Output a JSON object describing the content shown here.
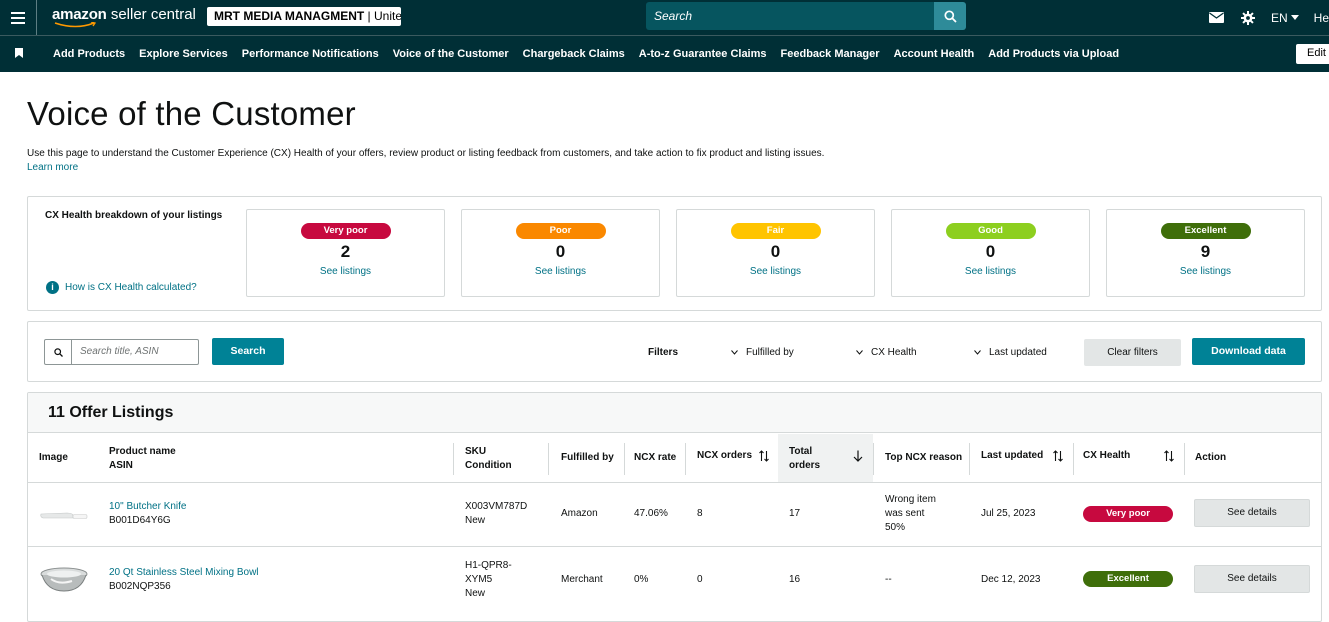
{
  "header": {
    "logo_brand": "amazon",
    "logo_product": "seller central",
    "account": "MRT MEDIA MANAGMENT",
    "account_rest": " | Unite...",
    "search_placeholder": "Search",
    "language": "EN",
    "help": "Hel"
  },
  "nav": {
    "items": [
      "Add Products",
      "Explore Services",
      "Performance Notifications",
      "Voice of the Customer",
      "Chargeback Claims",
      "A-to-z Guarantee Claims",
      "Feedback Manager",
      "Account Health",
      "Add Products via Upload"
    ],
    "edit": "Edit"
  },
  "page": {
    "title": "Voice of the Customer",
    "description": "Use this page to understand the Customer Experience (CX) Health of your offers, review product or listing feedback from customers, and take action to fix product and listing issues.",
    "learn_more": "Learn more"
  },
  "breakdown": {
    "label": "CX Health breakdown of your listings",
    "how_link": "How is CX Health calculated?",
    "cards": [
      {
        "label": "Very poor",
        "count": "2",
        "link": "See listings",
        "color": "#c7093f"
      },
      {
        "label": "Poor",
        "count": "0",
        "link": "See listings",
        "color": "#fa8800"
      },
      {
        "label": "Fair",
        "count": "0",
        "link": "See listings",
        "color": "#ffc400"
      },
      {
        "label": "Good",
        "count": "0",
        "link": "See listings",
        "color": "#8dcf1f"
      },
      {
        "label": "Excellent",
        "count": "9",
        "link": "See listings",
        "color": "#3f6e0a"
      }
    ]
  },
  "filters": {
    "search_placeholder": "Search title, ASIN",
    "search_button": "Search",
    "label": "Filters",
    "fulfilled_by": "Fulfilled by",
    "cx_health": "CX Health",
    "last_updated": "Last updated",
    "clear": "Clear filters",
    "download": "Download data"
  },
  "listings": {
    "heading": "11 Offer Listings",
    "columns": {
      "image": "Image",
      "product_name": "Product name",
      "asin": "ASIN",
      "sku": "SKU",
      "condition": "Condition",
      "fulfilled_by": "Fulfilled by",
      "ncx_rate": "NCX rate",
      "ncx_orders": "NCX orders",
      "total": "Total",
      "orders": "orders",
      "top_reason": "Top NCX reason",
      "last_updated": "Last updated",
      "cx_health": "CX Health",
      "action": "Action"
    },
    "rows": [
      {
        "name": "10\" Butcher Knife",
        "asin": "B001D64Y6G",
        "sku_line1": "X003VM787D",
        "sku_line2": "",
        "condition": "New",
        "fulfilled": "Amazon",
        "ncx_rate": "47.06%",
        "ncx_orders": "8",
        "total_orders": "17",
        "reason_line1": "Wrong item",
        "reason_line2": "was sent",
        "reason_line3": "50%",
        "updated": "Jul 25, 2023",
        "health": "Very poor",
        "health_color": "#c7093f",
        "action": "See details"
      },
      {
        "name": "20 Qt Stainless Steel Mixing Bowl",
        "asin": "B002NQP356",
        "sku_line1": "H1-QPR8-",
        "sku_line2": "XYM5",
        "condition": "New",
        "fulfilled": "Merchant",
        "ncx_rate": "0%",
        "ncx_orders": "0",
        "total_orders": "16",
        "reason_line1": "--",
        "reason_line2": "",
        "reason_line3": "",
        "updated": "Dec 12, 2023",
        "health": "Excellent",
        "health_color": "#3f6e0a",
        "action": "See details"
      }
    ]
  }
}
